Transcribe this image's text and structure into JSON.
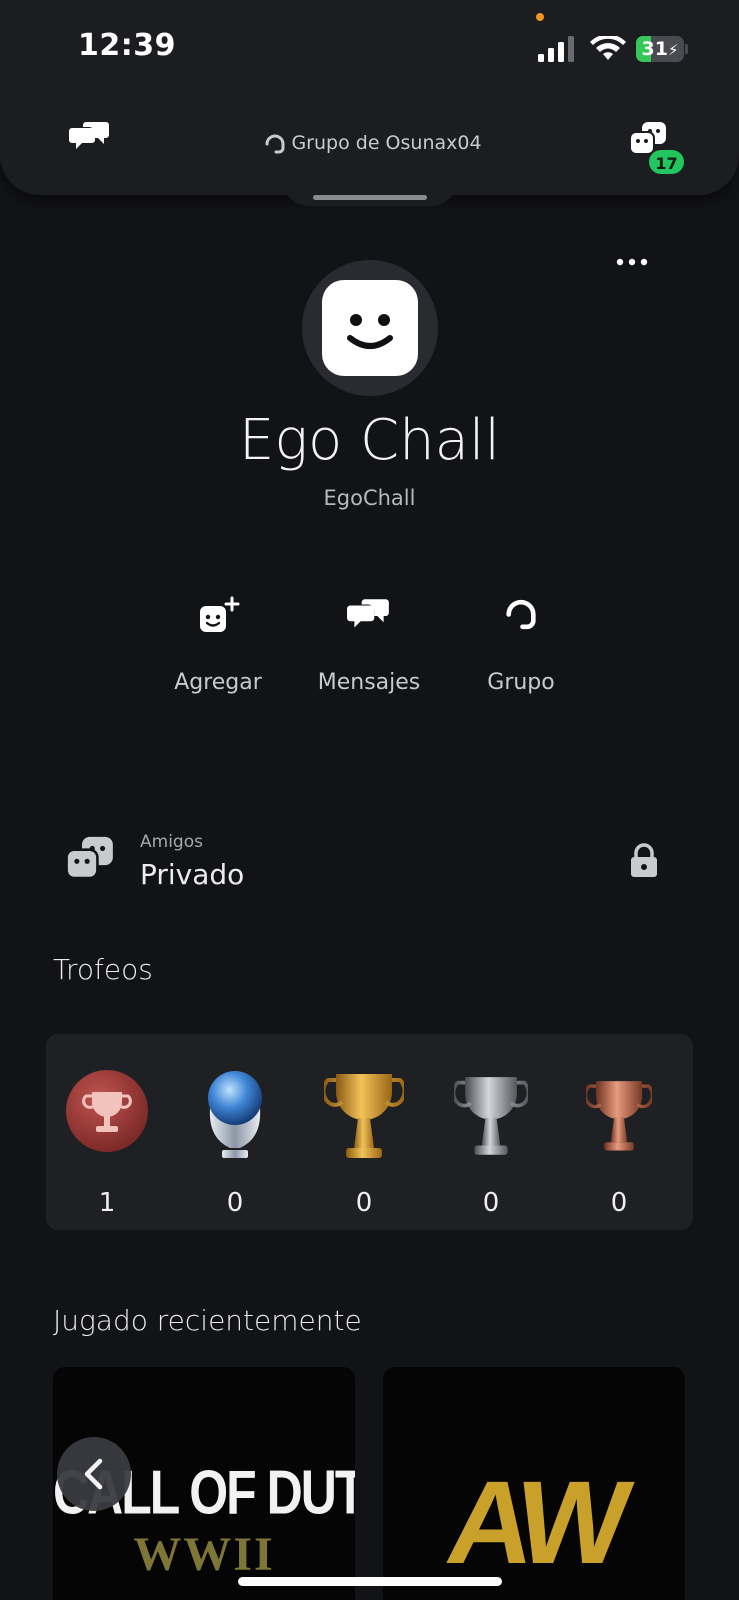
{
  "status_bar": {
    "time": "12:39",
    "battery": "31",
    "battery_level": 0.31,
    "colors": {
      "battery_fill": "#35c759",
      "privacy_dot": "#f2951f"
    }
  },
  "header": {
    "party_label": "Grupo de Osunax04",
    "friends_badge": "17",
    "icons": [
      "messages-icon",
      "headset-icon",
      "friends-icon"
    ]
  },
  "profile": {
    "display_name": "Ego Chall",
    "online_id": "EgoChall",
    "more_icon": "more-icon"
  },
  "actions": [
    {
      "label": "Agregar",
      "icon": "add-friend-icon"
    },
    {
      "label": "Mensajes",
      "icon": "messages-icon"
    },
    {
      "label": "Grupo",
      "icon": "headset-icon"
    }
  ],
  "friends": {
    "label": "Amigos",
    "value": "Privado",
    "icon": "friends-icon",
    "lock_icon": "lock-icon"
  },
  "trophies": {
    "title": "Trofeos",
    "items": [
      {
        "type": "level",
        "count": "1"
      },
      {
        "type": "platinum",
        "count": "0"
      },
      {
        "type": "gold",
        "count": "0"
      },
      {
        "type": "silver",
        "count": "0"
      },
      {
        "type": "bronze",
        "count": "0"
      }
    ]
  },
  "recent": {
    "title": "Jugado recientemente",
    "games": [
      {
        "logo_line1": "CALL OF DUTY",
        "logo_line2": "WWII"
      },
      {
        "logo": "AW"
      }
    ]
  },
  "accent": "#22c55e"
}
